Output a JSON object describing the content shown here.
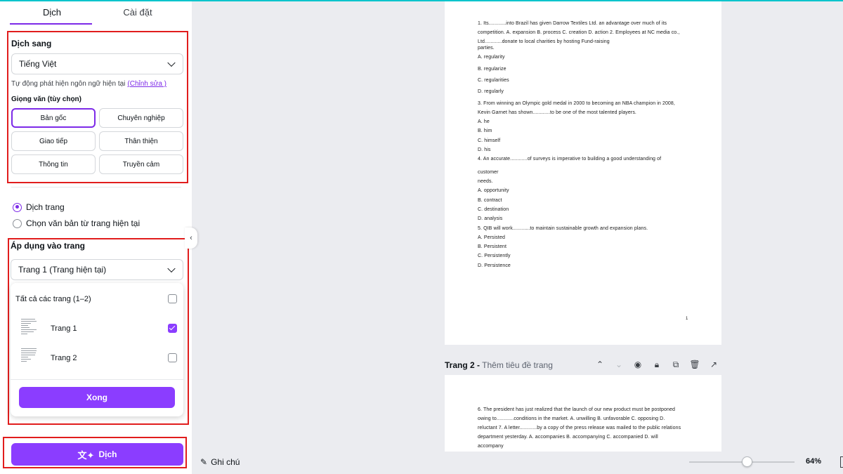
{
  "tabs": {
    "translate": "Dịch",
    "settings": "Cài đặt"
  },
  "translate_to": {
    "title": "Dịch sang",
    "language": "Tiếng Việt",
    "auto_detect_text": "Tự động phát hiện ngôn ngữ hiện tại",
    "auto_detect_link": "(Chỉnh sửa )"
  },
  "tone": {
    "title": "Giọng văn (tùy chọn)",
    "options": [
      "Bản gốc",
      "Chuyên nghiệp",
      "Giao tiếp",
      "Thân thiện",
      "Thông tin",
      "Truyền cảm"
    ],
    "selected": "Bản gốc"
  },
  "scope": {
    "options": [
      "Dịch trang",
      "Chọn văn bản từ trang hiện tại"
    ],
    "selected": "Dịch trang"
  },
  "apply": {
    "title": "Áp dụng vào trang",
    "selected": "Trang 1 (Trang hiện tại)",
    "all_pages": "Tất cả các trang (1–2)",
    "pages": [
      {
        "label": "Trang 1",
        "checked": true
      },
      {
        "label": "Trang 2",
        "checked": false
      }
    ],
    "done": "Xong"
  },
  "translate_button": "Dịch",
  "accent_color": "#8b3dff",
  "document": {
    "page1_lines": [
      "1. Its............into Brazil has given Darrow Textiles Ltd. an advantage over much of its",
      "competition. A. expansion B. process C. creation D. action 2. Employees at NC media co.,",
      "Ltd............donate to local charities by hosting Fund-raising",
      "parties.",
      "A. regularity",
      "B. regularize",
      "C. regularities",
      "D. regularly",
      "3. From winning an Olympic gold medal in 2000 to becoming an NBA champion in 2008,",
      "Kevin Garnet has shown............to be one of the most talented players.",
      "A. he",
      "B. him",
      "C. himself",
      "D. his",
      "4.  An  accurate............of  surveys  is  imperative  to  building  a  good  understanding  of",
      "customer",
      "needs.",
      "A. opportunity",
      "B. contract",
      "C. destination",
      "D. analysis",
      "5. QIB will work............to maintain sustainable growth and expansion plans.",
      "A. Persisted",
      "B. Persistent",
      "C. Persistently",
      "D. Persistence"
    ],
    "page1_number": "1",
    "page2_label": "Trang 2 -",
    "page2_title_placeholder": "Thêm tiêu đề trang",
    "page2_lines": [
      "6. The president has just realized that the launch of our new product must be postponed",
      "owing  to............conditions  in  the  market.  A.  unwilling  B.  unfavorable  C.  opposing  D.",
      "reluctant 7. A letter............by a copy of the press release was mailed to the public relations",
      "department  yesterday.  A.  accompanies  B.  accompanying  C.  accompanied  D.  will",
      "accompany"
    ]
  },
  "bottom_bar": {
    "notes": "Ghi chú",
    "zoom": "64%",
    "zoom_fraction": 0.55
  }
}
